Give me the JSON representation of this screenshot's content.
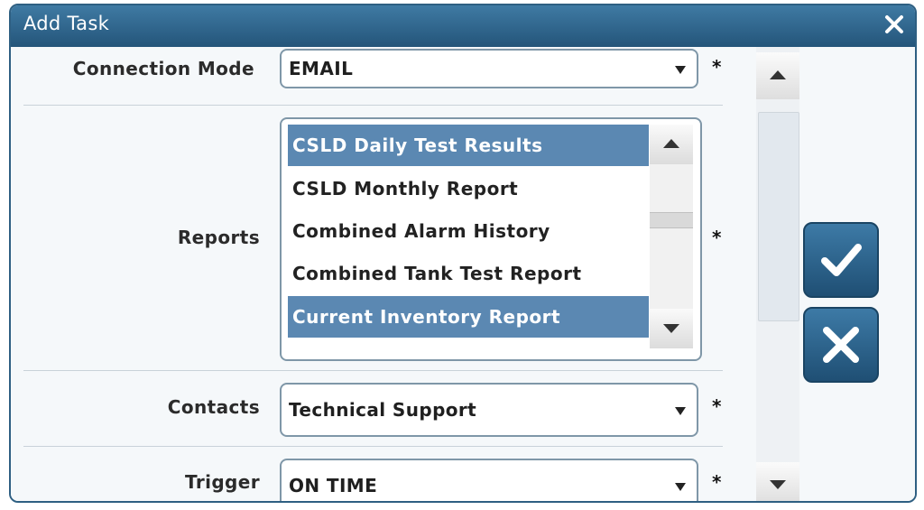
{
  "dialog": {
    "title": "Add Task",
    "close_icon": "close-icon"
  },
  "fields": {
    "connection_mode": {
      "label": "Connection Mode",
      "value": "EMAIL",
      "required": "*"
    },
    "reports": {
      "label": "Reports",
      "required": "*",
      "items": [
        {
          "label": "CSLD Daily Test Results",
          "selected": true
        },
        {
          "label": "CSLD Monthly Report",
          "selected": false
        },
        {
          "label": "Combined Alarm History",
          "selected": false
        },
        {
          "label": "Combined Tank Test Report",
          "selected": false
        },
        {
          "label": "Current Inventory Report",
          "selected": true
        }
      ]
    },
    "contacts": {
      "label": "Contacts",
      "value": "Technical Support",
      "required": "*"
    },
    "trigger": {
      "label": "Trigger",
      "value": "ON TIME",
      "required": "*"
    }
  },
  "actions": {
    "confirm_icon": "checkmark-icon",
    "cancel_icon": "x-icon"
  },
  "colors": {
    "titlebar": "#2f6a93",
    "selection": "#5b88b2",
    "button": "#2a5f86"
  }
}
